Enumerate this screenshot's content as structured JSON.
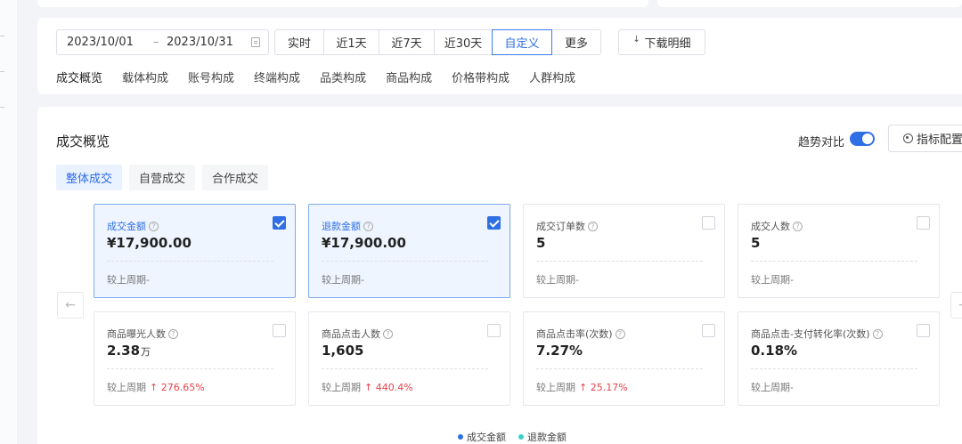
{
  "filters": {
    "date_start": "2023/10/01",
    "date_separator": "–",
    "date_end": "2023/10/31",
    "periods": [
      "实时",
      "近1天",
      "近7天",
      "近30天",
      "自定义",
      "更多"
    ],
    "active_period": "自定义",
    "download_label": "下载明细"
  },
  "sub_tabs": [
    "成交概览",
    "载体构成",
    "账号构成",
    "终端构成",
    "品类构成",
    "商品构成",
    "价格带构成",
    "人群构成"
  ],
  "overview": {
    "title": "成交概览",
    "trend_label": "趋势对比",
    "trend_enabled": true,
    "config_label": "指标配置",
    "segments": [
      "整体成交",
      "自营成交",
      "合作成交"
    ],
    "active_segment": "整体成交",
    "prev_arrow": "←",
    "next_arrow": "→"
  },
  "metrics": [
    {
      "label": "成交金额",
      "value": "¥17,900.00",
      "unit": "",
      "compare_label": "较上周期",
      "change": "-",
      "trend": "none",
      "checked": true
    },
    {
      "label": "退款金额",
      "value": "¥17,900.00",
      "unit": "",
      "compare_label": "较上周期",
      "change": "-",
      "trend": "none",
      "checked": true
    },
    {
      "label": "成交订单数",
      "value": "5",
      "unit": "",
      "compare_label": "较上周期",
      "change": "-",
      "trend": "none",
      "checked": false
    },
    {
      "label": "成交人数",
      "value": "5",
      "unit": "",
      "compare_label": "较上周期",
      "change": "-",
      "trend": "none",
      "checked": false
    },
    {
      "label": "商品曝光人数",
      "value": "2.38",
      "unit": "万",
      "compare_label": "较上周期",
      "change": "↑ 276.65%",
      "trend": "up",
      "checked": false
    },
    {
      "label": "商品点击人数",
      "value": "1,605",
      "unit": "",
      "compare_label": "较上周期",
      "change": "↑ 440.4%",
      "trend": "up",
      "checked": false
    },
    {
      "label": "商品点击率(次数)",
      "value": "7.27%",
      "unit": "",
      "compare_label": "较上周期",
      "change": "↑ 25.17%",
      "trend": "up",
      "checked": false
    },
    {
      "label": "商品点击-支付转化率(次数)",
      "value": "0.18%",
      "unit": "",
      "compare_label": "较上周期",
      "change": "-",
      "trend": "none",
      "checked": false
    }
  ],
  "legend": [
    {
      "name": "成交金额",
      "color": "#2f6fe6"
    },
    {
      "name": "退款金额",
      "color": "#3ccfcf"
    }
  ],
  "colors": {
    "accent": "#2f6fe6",
    "up": "#e8434a"
  }
}
